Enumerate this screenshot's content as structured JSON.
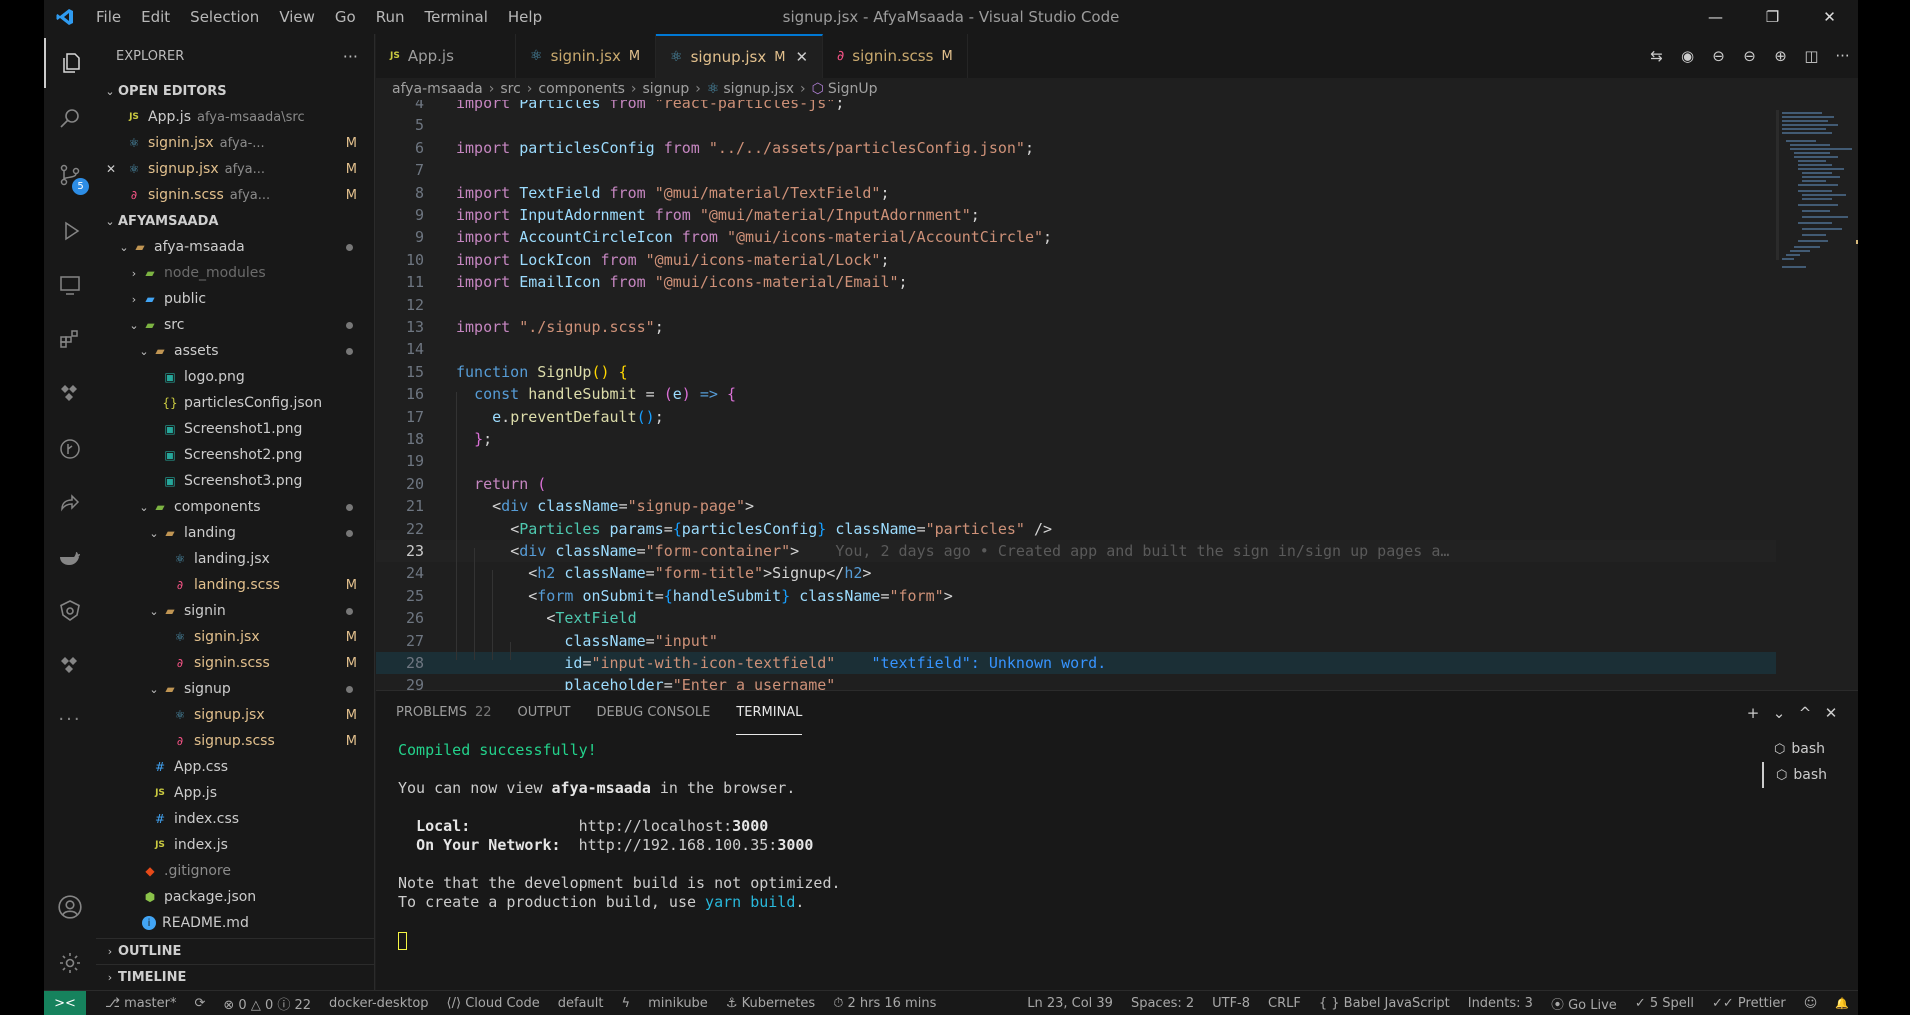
{
  "menu": [
    "File",
    "Edit",
    "Selection",
    "View",
    "Go",
    "Run",
    "Terminal",
    "Help"
  ],
  "window_title": "signup.jsx - AfyaMsaada - Visual Studio Code",
  "window_controls": {
    "minimize": "—",
    "restore": "❐",
    "close": "✕"
  },
  "activity": {
    "scm_badge": "5"
  },
  "explorer": {
    "title": "EXPLORER",
    "more": "···",
    "open_editors_label": "OPEN EDITORS",
    "workspace_label": "AFYAMSAADA",
    "outline_label": "OUTLINE",
    "timeline_label": "TIMELINE",
    "open_editors": [
      {
        "name": "App.js",
        "desc": "afya-msaada\\src",
        "stat": "",
        "icon": "js"
      },
      {
        "name": "signin.jsx",
        "desc": "afya-...",
        "stat": "M",
        "icon": "react"
      },
      {
        "name": "signup.jsx",
        "desc": "afya...",
        "stat": "M",
        "icon": "react",
        "close": "✕"
      },
      {
        "name": "signin.scss",
        "desc": "afya...",
        "stat": "M",
        "icon": "scss"
      }
    ],
    "tree": [
      {
        "name": "afya-msaada",
        "depth": 1,
        "chev": "⌄",
        "icon": "folder"
      },
      {
        "name": "node_modules",
        "depth": 2,
        "chev": "›",
        "icon": "folder-green",
        "dim": true
      },
      {
        "name": "public",
        "depth": 2,
        "chev": "›",
        "icon": "folder-blue"
      },
      {
        "name": "src",
        "depth": 2,
        "chev": "⌄",
        "icon": "folder-green"
      },
      {
        "name": "assets",
        "depth": 3,
        "chev": "⌄",
        "icon": "folder"
      },
      {
        "name": "logo.png",
        "depth": 4,
        "icon": "img"
      },
      {
        "name": "particlesConfig.json",
        "depth": 4,
        "icon": "json"
      },
      {
        "name": "Screenshot1.png",
        "depth": 4,
        "icon": "img"
      },
      {
        "name": "Screenshot2.png",
        "depth": 4,
        "icon": "img"
      },
      {
        "name": "Screenshot3.png",
        "depth": 4,
        "icon": "img"
      },
      {
        "name": "components",
        "depth": 3,
        "chev": "⌄",
        "icon": "folder-green"
      },
      {
        "name": "landing",
        "depth": 4,
        "chev": "⌄",
        "icon": "folder"
      },
      {
        "name": "landing.jsx",
        "depth": 5,
        "icon": "react"
      },
      {
        "name": "landing.scss",
        "depth": 5,
        "icon": "scss",
        "stat": "M"
      },
      {
        "name": "signin",
        "depth": 4,
        "chev": "⌄",
        "icon": "folder"
      },
      {
        "name": "signin.jsx",
        "depth": 5,
        "icon": "react",
        "stat": "M"
      },
      {
        "name": "signin.scss",
        "depth": 5,
        "icon": "scss",
        "stat": "M"
      },
      {
        "name": "signup",
        "depth": 4,
        "chev": "⌄",
        "icon": "folder"
      },
      {
        "name": "signup.jsx",
        "depth": 5,
        "icon": "react",
        "stat": "M"
      },
      {
        "name": "signup.scss",
        "depth": 5,
        "icon": "scss",
        "stat": "M"
      },
      {
        "name": "App.css",
        "depth": 3,
        "icon": "css"
      },
      {
        "name": "App.js",
        "depth": 3,
        "icon": "js"
      },
      {
        "name": "index.css",
        "depth": 3,
        "icon": "css"
      },
      {
        "name": "index.js",
        "depth": 3,
        "icon": "js"
      },
      {
        "name": ".gitignore",
        "depth": 2,
        "icon": "git"
      },
      {
        "name": "package.json",
        "depth": 2,
        "icon": "npm"
      },
      {
        "name": "README.md",
        "depth": 2,
        "icon": "info"
      }
    ]
  },
  "tabs": [
    {
      "name": "App.js",
      "stat": "",
      "icon": "js"
    },
    {
      "name": "signin.jsx",
      "stat": "M",
      "icon": "react"
    },
    {
      "name": "signup.jsx",
      "stat": "M",
      "icon": "react",
      "active": true,
      "close": "✕"
    },
    {
      "name": "signin.scss",
      "stat": "M",
      "icon": "scss"
    }
  ],
  "breadcrumbs": [
    "afya-msaada",
    "src",
    "components",
    "signup",
    "signup.jsx",
    "SignUp"
  ],
  "code_lines": [
    {
      "n": "4",
      "html": "<span class='k'>import</span> <span class='v'>Particles</span> <span class='k'>from</span> <span class='s'>\"react-particles-js\"</span><span class='p'>;</span>"
    },
    {
      "n": "5",
      "html": ""
    },
    {
      "n": "6",
      "html": "<span class='k'>import</span> <span class='v'>particlesConfig</span> <span class='k'>from</span> <span class='s'>\"../../assets/particlesConfig.json\"</span><span class='p'>;</span>"
    },
    {
      "n": "7",
      "html": ""
    },
    {
      "n": "8",
      "html": "<span class='k'>import</span> <span class='v'>TextField</span> <span class='k'>from</span> <span class='s'>\"@mui/material/TextField\"</span><span class='p'>;</span>"
    },
    {
      "n": "9",
      "html": "<span class='k'>import</span> <span class='v'>InputAdornment</span> <span class='k'>from</span> <span class='s'>\"@mui/material/InputAdornment\"</span><span class='p'>;</span>"
    },
    {
      "n": "9",
      "html": "<span class='k'>import</span> <span class='v'>AccountCircleIcon</span> <span class='k'>from</span> <span class='s'>\"@mui/icons-material/AccountCircle\"</span><span class='p'>;</span>"
    },
    {
      "n": "10",
      "html": "<span class='k'>import</span> <span class='v'>LockIcon</span> <span class='k'>from</span> <span class='s'>\"@mui/icons-material/Lock\"</span><span class='p'>;</span>"
    },
    {
      "n": "11",
      "html": "<span class='k'>import</span> <span class='v'>EmailIcon</span> <span class='k'>from</span> <span class='s'>\"@mui/icons-material/Email\"</span><span class='p'>;</span>"
    },
    {
      "n": "12",
      "html": ""
    },
    {
      "n": "13",
      "html": "<span class='k'>import</span> <span class='s'>\"./signup.scss\"</span><span class='p'>;</span>"
    },
    {
      "n": "14",
      "html": ""
    },
    {
      "n": "15",
      "html": "<span class='kw'>function</span> <span class='f'>SignUp</span><span class='br1'>()</span> <span class='br1'>{</span>"
    },
    {
      "n": "16",
      "html": "  <span class='kw'>const</span> <span class='f'>handleSubmit</span> <span class='p'>=</span> <span class='br2'>(</span><span class='v'>e</span><span class='br2'>)</span> <span class='kw'>=&gt;</span> <span class='br2'>{</span>"
    },
    {
      "n": "17",
      "html": "    <span class='v'>e</span><span class='p'>.</span><span class='f'>preventDefault</span><span class='br3'>()</span><span class='p'>;</span>"
    },
    {
      "n": "18",
      "html": "  <span class='br2'>}</span><span class='p'>;</span>"
    },
    {
      "n": "19",
      "html": ""
    },
    {
      "n": "20",
      "html": "  <span class='k'>return</span> <span class='br2'>(</span>"
    },
    {
      "n": "21",
      "html": "    <span class='p'>&lt;</span><span class='tag'>div</span> <span class='v'>className</span><span class='p'>=</span><span class='s'>\"signup-page\"</span><span class='p'>&gt;</span>"
    },
    {
      "n": "22",
      "html": "      <span class='p'>&lt;</span><span class='t'>Particles</span> <span class='v'>params</span><span class='p'>=</span><span class='br3'>{</span><span class='v'>particlesConfig</span><span class='br3'>}</span> <span class='v'>className</span><span class='p'>=</span><span class='s'>\"particles\"</span> <span class='p'>/&gt;</span>"
    },
    {
      "n": "23",
      "html": "      <span class='p'>&lt;</span><span class='tag'>div</span> <span class='v'>className</span><span class='p'>=</span><span class='s'>\"form-container\"</span><span class='p'>&gt;</span>    <span class='ghost'>You, 2 days ago • Created app and built the sign in/sign up pages a…</span>",
      "cur": true
    },
    {
      "n": "24",
      "html": "        <span class='p'>&lt;</span><span class='tag'>h2</span> <span class='v'>className</span><span class='p'>=</span><span class='s'>\"form-title\"</span><span class='p'>&gt;</span><span class='p'>Signup</span><span class='p'>&lt;/</span><span class='tag'>h2</span><span class='p'>&gt;</span>"
    },
    {
      "n": "25",
      "html": "        <span class='p'>&lt;</span><span class='tag'>form</span> <span class='v'>onSubmit</span><span class='p'>=</span><span class='br3'>{</span><span class='v'>handleSubmit</span><span class='br3'>}</span> <span class='v'>className</span><span class='p'>=</span><span class='s'>\"form\"</span><span class='p'>&gt;</span>"
    },
    {
      "n": "26",
      "html": "          <span class='p'>&lt;</span><span class='t'>TextField</span>"
    },
    {
      "n": "27",
      "html": "            <span class='v'>className</span><span class='p'>=</span><span class='s'>\"input\"</span>"
    },
    {
      "n": "28",
      "html": "            <span class='v'>id</span><span class='p'>=</span><span class='s'>\"input-with-icon-textfield\"</span>    <span class='diagtxt'>\"textfield\": Unknown word.</span>",
      "diag": true
    },
    {
      "n": "29",
      "html": "            <span class='v'>placeholder</span><span class='p'>=</span><span class='s'>\"Enter a username\"</span>"
    }
  ],
  "panel": {
    "tabs": [
      {
        "label": "PROBLEMS",
        "count": "22"
      },
      {
        "label": "OUTPUT"
      },
      {
        "label": "DEBUG CONSOLE"
      },
      {
        "label": "TERMINAL",
        "active": true
      }
    ],
    "terminals": [
      "bash",
      "bash"
    ],
    "terminal_lines": [
      {
        "html": "Compiled successfully!",
        "cls": "green"
      },
      {
        "html": ""
      },
      {
        "html": "You can now view <span class='b'>afya-msaada</span> in the browser."
      },
      {
        "html": ""
      },
      {
        "html": "  <span class='b'>Local:</span>            http://localhost:<span class='b'>3000</span>"
      },
      {
        "html": "  <span class='b'>On Your Network:</span>  http://192.168.100.35:<span class='b'>3000</span>"
      },
      {
        "html": ""
      },
      {
        "html": "Note that the development build is not optimized."
      },
      {
        "html": "To create a production build, use <span class='cy'>yarn build</span>."
      },
      {
        "html": ""
      },
      {
        "html": "<span class='cursor'></span>"
      }
    ]
  },
  "status": {
    "branch": "master*",
    "errors": "0",
    "warnings": "0",
    "infos": "22",
    "left_items": [
      "docker-desktop",
      "Cloud Code",
      "default",
      "minikube",
      "Kubernetes",
      "2 hrs 16 mins"
    ],
    "right_items": [
      "Ln 23, Col 39",
      "Spaces: 2",
      "UTF-8",
      "CRLF",
      "{ } Babel JavaScript",
      "Indents: 3",
      "Go Live",
      "5 Spell",
      "Prettier"
    ]
  }
}
